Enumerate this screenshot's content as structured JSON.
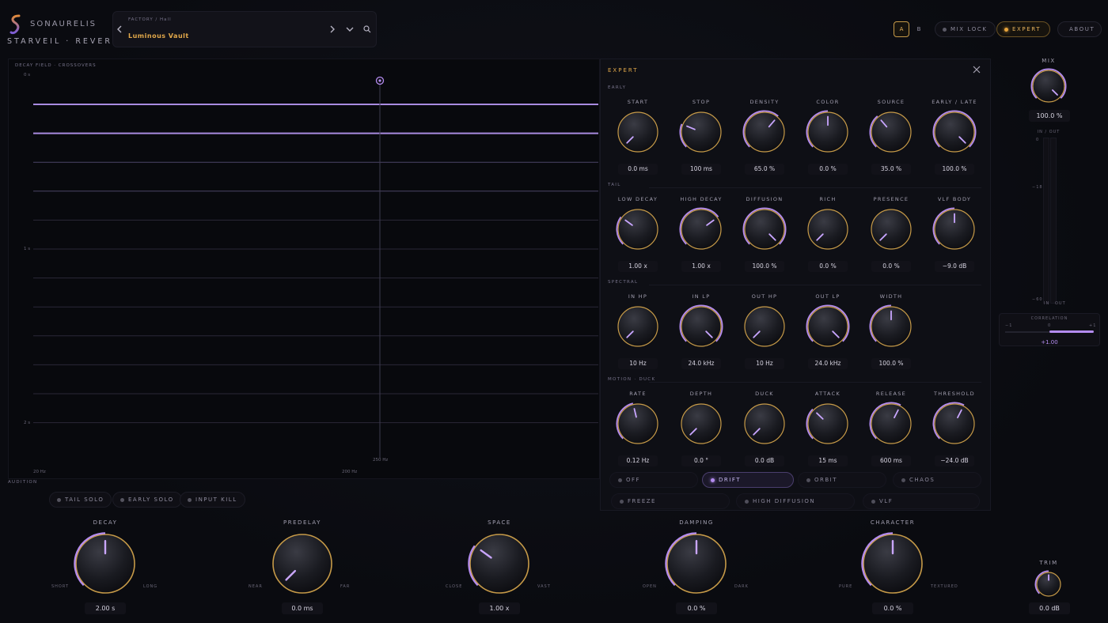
{
  "brand": {
    "name": "SONAURELIS",
    "product": "STARVEIL · REVERB"
  },
  "preset": {
    "path": "FACTORY / Hall",
    "name": "Luminous Vault"
  },
  "topbar": {
    "a_label": "A",
    "b_label": "B",
    "mix_lock_label": "MIX LOCK",
    "expert_label": "EXPERT",
    "about_label": "ABOUT"
  },
  "plot": {
    "title": "DECAY FIELD · CROSSOVERS",
    "y_ticks": [
      "0 s",
      "1 s",
      "2 s"
    ],
    "x_ticks": [
      "20 Hz",
      "200 Hz"
    ],
    "cursor_label": "250 Hz"
  },
  "expert": {
    "title": "EXPERT",
    "sections": [
      {
        "name": "EARLY",
        "knobs": [
          {
            "label": "START",
            "value": "0.0 ms",
            "level": 0.0
          },
          {
            "label": "STOP",
            "value": "100 ms",
            "level": 0.25
          },
          {
            "label": "DENSITY",
            "value": "65.0 %",
            "level": 0.65
          },
          {
            "label": "COLOR",
            "value": "0.0 %",
            "level": 0.5
          },
          {
            "label": "SOURCE",
            "value": "35.0 %",
            "level": 0.35
          },
          {
            "label": "EARLY / LATE",
            "value": "100.0 %",
            "level": 1.0
          }
        ]
      },
      {
        "name": "TAIL",
        "knobs": [
          {
            "label": "LOW DECAY",
            "value": "1.00 x",
            "level": 0.3
          },
          {
            "label": "HIGH DECAY",
            "value": "1.00 x",
            "level": 0.7
          },
          {
            "label": "DIFFUSION",
            "value": "100.0 %",
            "level": 1.0
          },
          {
            "label": "RICH",
            "value": "0.0 %",
            "level": 0.0
          },
          {
            "label": "PRESENCE",
            "value": "0.0 %",
            "level": 0.0
          },
          {
            "label": "VLF BODY",
            "value": "−9.0 dB",
            "level": 0.5
          }
        ]
      },
      {
        "name": "SPECTRAL",
        "knobs": [
          {
            "label": "IN HP",
            "value": "10 Hz",
            "level": 0.0
          },
          {
            "label": "IN LP",
            "value": "24.0 kHz",
            "level": 1.0
          },
          {
            "label": "OUT HP",
            "value": "10 Hz",
            "level": 0.0
          },
          {
            "label": "OUT LP",
            "value": "24.0 kHz",
            "level": 1.0
          },
          {
            "label": "WIDTH",
            "value": "100.0 %",
            "level": 0.5
          }
        ]
      },
      {
        "name": "MOTION · DUCK",
        "knobs": [
          {
            "label": "RATE",
            "value": "0.12 Hz",
            "level": 0.45
          },
          {
            "label": "DEPTH",
            "value": "0.0 °",
            "level": 0.0
          },
          {
            "label": "DUCK",
            "value": "0.0 dB",
            "level": 0.0
          },
          {
            "label": "ATTACK",
            "value": "15 ms",
            "level": 0.33
          },
          {
            "label": "RELEASE",
            "value": "600 ms",
            "level": 0.6
          },
          {
            "label": "THRESHOLD",
            "value": "−24.0 dB",
            "level": 0.6
          }
        ]
      }
    ],
    "modes": [
      "OFF",
      "DRIFT",
      "ORBIT",
      "CHAOS"
    ],
    "active_mode": "DRIFT",
    "extras": [
      "FREEZE",
      "HIGH DIFFUSION",
      "VLF"
    ]
  },
  "audition": {
    "label": "AUDITION",
    "buttons": [
      "TAIL SOLO",
      "EARLY SOLO",
      "INPUT KILL"
    ]
  },
  "macros": [
    {
      "label": "DECAY",
      "value": "2.00 s",
      "left": "SHORT",
      "right": "LONG",
      "level": 0.5
    },
    {
      "label": "PREDELAY",
      "value": "0.0 ms",
      "left": "NEAR",
      "right": "FAR",
      "level": 0.0
    },
    {
      "label": "SPACE",
      "value": "1.00 x",
      "left": "CLOSE",
      "right": "VAST",
      "level": 0.3
    },
    {
      "label": "DAMPING",
      "value": "0.0 %",
      "left": "OPEN",
      "right": "DARK",
      "level": 0.5
    },
    {
      "label": "CHARACTER",
      "value": "0.0 %",
      "left": "PURE",
      "right": "TEXTURED",
      "level": 0.5
    }
  ],
  "right_rail": {
    "mix_label": "MIX",
    "mix_value": "100.0 %",
    "mix_level": 1.0,
    "io_label": "IN / OUT",
    "meter_ticks": [
      "0",
      "−18",
      "−60"
    ],
    "meter_in": "IN",
    "meter_out": "OUT",
    "correlation_label": "CORRELATION",
    "corr_min": "−1",
    "corr_mid": "0",
    "corr_max": "+1",
    "correlation_value": "+1.00",
    "trim_label": "TRIM",
    "trim_value": "0.0 dB",
    "trim_level": 0.5
  },
  "colors": {
    "accent": "#b48cf0",
    "gold": "#e3a94a",
    "ring": "#c69a48"
  }
}
